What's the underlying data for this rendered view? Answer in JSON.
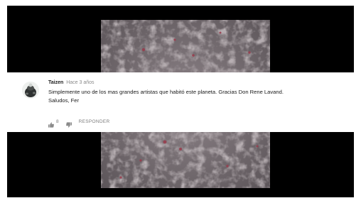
{
  "comment": {
    "author": "Taizen",
    "timestamp": "Hace 3 años",
    "text_line1": "Simplemente uno de los mas grandes artistas que habitó este planeta. Gracias Don Rene Lavand.",
    "text_line2": "Saludos, Fer",
    "likes": "8",
    "reply_label": "RESPONDER",
    "icons": {
      "avatar": "avatar-icon",
      "like": "thumbs-up-icon",
      "dislike": "thumbs-down-icon"
    }
  },
  "colors": {
    "background": "#ffffff",
    "video_bg": "#000000",
    "author": "#202020",
    "muted": "#8a8a8a",
    "text": "#1a1a1a"
  }
}
